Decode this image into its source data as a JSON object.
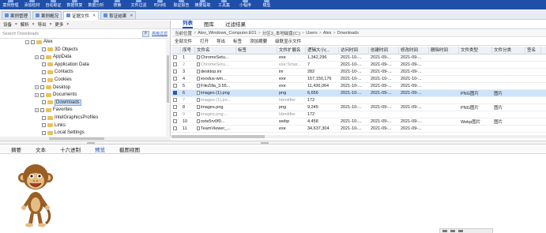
{
  "toolbar": {
    "items": [
      {
        "label": "案例管理",
        "icon": "folder-icon"
      },
      {
        "label": "添加检材",
        "icon": "add-icon"
      },
      {
        "label": "自动取证",
        "icon": "auto-icon"
      },
      {
        "label": "数据恢复",
        "icon": "restore-icon"
      },
      {
        "label": "数据分析",
        "icon": "analysis-icon"
      },
      {
        "label": "搜索",
        "icon": "search-icon"
      },
      {
        "label": "文件过滤",
        "icon": "filter-icon"
      },
      {
        "label": "时间线",
        "icon": "timeline-icon"
      },
      {
        "label": "取证报告",
        "icon": "report-icon"
      },
      {
        "label": "摘要提取",
        "icon": "extract-icon"
      },
      {
        "label": "工具集",
        "icon": "tools-icon"
      },
      {
        "label": "小程序",
        "icon": "applet-icon"
      },
      {
        "label": "模型",
        "icon": "model-icon"
      }
    ]
  },
  "case_tabs": [
    {
      "label": "案例管理",
      "active": false
    },
    {
      "label": "案例概况",
      "active": false
    },
    {
      "label": "证据文件",
      "active": true
    },
    {
      "label": "取证结果",
      "active": false
    }
  ],
  "left_panel": {
    "toolbar": [
      "设备",
      "解析",
      "导出",
      "更多"
    ],
    "search_placeholder": "Search Downloads",
    "advanced_filter": "高级过滤",
    "tree": [
      {
        "label": "Alex",
        "expander": "-",
        "level": 0
      },
      {
        "label": "3D Objects",
        "expander": "",
        "level": 1
      },
      {
        "label": "AppData",
        "expander": "+",
        "level": 1
      },
      {
        "label": "Application Data",
        "expander": "",
        "level": 1
      },
      {
        "label": "Contacts",
        "expander": "",
        "level": 1
      },
      {
        "label": "Cookies",
        "expander": "",
        "level": 1
      },
      {
        "label": "Desktop",
        "expander": "+",
        "level": 1
      },
      {
        "label": "Documents",
        "expander": "+",
        "level": 1
      },
      {
        "label": "Downloads",
        "expander": "",
        "level": 1,
        "selected": true
      },
      {
        "label": "Favorites",
        "expander": "+",
        "level": 1
      },
      {
        "label": "IntelGraphicsProfiles",
        "expander": "",
        "level": 1
      },
      {
        "label": "Links",
        "expander": "",
        "level": 1
      },
      {
        "label": "Local Settings",
        "expander": "",
        "level": 1
      }
    ]
  },
  "right_panel": {
    "tabs": [
      {
        "label": "列表",
        "active": true
      },
      {
        "label": "图库",
        "active": false
      },
      {
        "label": "过滤结果",
        "active": false
      }
    ],
    "breadcrumb": [
      "当前位置",
      "Alex_Windows_Computer.E01",
      "分区3_本地磁盘(C:)",
      "Users",
      "Alex",
      "Downloads"
    ],
    "toolbar": [
      "全部文件",
      "打开",
      "导出",
      "标签",
      "添加摘要",
      "级联显示文件"
    ],
    "columns": [
      "",
      "序号",
      "文件名",
      "标签",
      "文件扩展名",
      "逻辑大小(...",
      "访问时间",
      "创建时间",
      "修改时间",
      "删除时间",
      "文件类型",
      "文件分类",
      "签名"
    ],
    "rows": [
      {
        "n": "1",
        "name": "ChromeSetu...",
        "ext": "exe",
        "size": "1,342,296",
        "atime": "2021-10-...",
        "ctime": "2021-09-...",
        "mtime": "2021-09-...",
        "dtime": "",
        "ftype": "",
        "fclass": "",
        "muted": false,
        "sel": false
      },
      {
        "n": "2",
        "name": "ChromeSetu...",
        "ext": "exe:Smar...",
        "size": "7",
        "atime": "2021-10-...",
        "ctime": "2021-09-...",
        "mtime": "2021-09-...",
        "dtime": "",
        "ftype": "",
        "fclass": "",
        "muted": true,
        "sel": false
      },
      {
        "n": "3",
        "name": "desktop.ini",
        "ext": "ini",
        "size": "282",
        "atime": "2021-10-...",
        "ctime": "2021-09-...",
        "mtime": "2021-09-...",
        "dtime": "",
        "ftype": "",
        "fclass": "",
        "muted": false,
        "sel": false
      },
      {
        "n": "4",
        "name": "exodus-win...",
        "ext": "exe",
        "size": "157,150,176",
        "atime": "2021-10-...",
        "ctime": "2021-10-...",
        "mtime": "2021-10-...",
        "dtime": "",
        "ftype": "",
        "fclass": "",
        "muted": false,
        "sel": false
      },
      {
        "n": "5",
        "name": "FileZilla_3.55...",
        "ext": "exe",
        "size": "11,436,064",
        "atime": "2021-10-...",
        "ctime": "2021-09-...",
        "mtime": "2021-09-...",
        "dtime": "",
        "ftype": "",
        "fclass": "",
        "muted": false,
        "sel": false
      },
      {
        "n": "6",
        "name": "images (1).png",
        "ext": "png",
        "size": "6,656",
        "atime": "2021-10-...",
        "ctime": "2021-09-...",
        "mtime": "2021-09-...",
        "dtime": "",
        "ftype": "PNG图片",
        "fclass": "图片",
        "muted": false,
        "sel": true
      },
      {
        "n": "7",
        "name": "images (1).pn...",
        "ext": "Identifier",
        "size": "172",
        "atime": "",
        "ctime": "",
        "mtime": "",
        "dtime": "",
        "ftype": "",
        "fclass": "",
        "muted": true,
        "sel": false
      },
      {
        "n": "8",
        "name": "images.png",
        "ext": "png",
        "size": "9,245",
        "atime": "2021-10-...",
        "ctime": "2021-09-...",
        "mtime": "2021-09-...",
        "dtime": "",
        "ftype": "PNG图片",
        "fclass": "图片",
        "muted": false,
        "sel": false
      },
      {
        "n": "9",
        "name": "images.png:...",
        "ext": "Identifier",
        "size": "172",
        "atime": "",
        "ctime": "",
        "mtime": "",
        "dtime": "",
        "ftype": "",
        "fclass": "",
        "muted": true,
        "sel": false
      },
      {
        "n": "10",
        "name": "oxte5rv0f0...",
        "ext": "webp",
        "size": "4,458",
        "atime": "2021-10-...",
        "ctime": "2021-09-...",
        "mtime": "2021-09-...",
        "dtime": "",
        "ftype": "Webp图片",
        "fclass": "图片",
        "muted": false,
        "sel": false
      },
      {
        "n": "11",
        "name": "TeamViewer_...",
        "ext": "exe",
        "size": "34,637,304",
        "atime": "2021-10-...",
        "ctime": "2021-09-...",
        "mtime": "2021-09-...",
        "dtime": "",
        "ftype": "",
        "fclass": "",
        "muted": false,
        "sel": false
      }
    ]
  },
  "preview_tabs": [
    {
      "label": "摘要",
      "active": false
    },
    {
      "label": "文本",
      "active": false
    },
    {
      "label": "十六进制",
      "active": false
    },
    {
      "label": "预览",
      "active": true
    },
    {
      "label": "截图视图",
      "active": false
    }
  ],
  "colors": {
    "brand": "#1f4fa8",
    "selection": "#cfe3fb",
    "folder": "#e8c35a"
  }
}
